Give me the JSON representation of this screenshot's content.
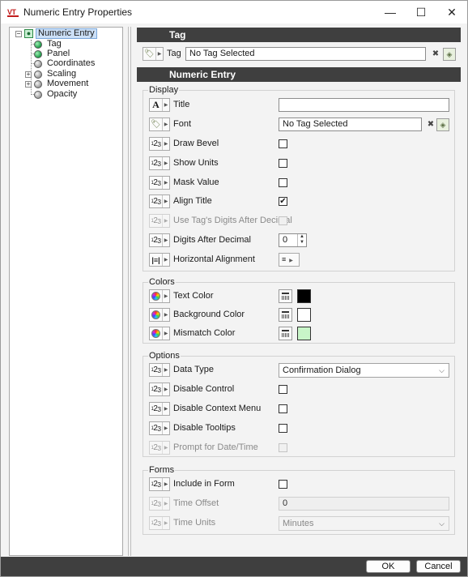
{
  "window": {
    "title": "Numeric Entry Properties",
    "logo": "VT",
    "controls": {
      "minimize": "—",
      "maximize": "☐",
      "close": "✕"
    }
  },
  "tree": {
    "root": {
      "label": "Numeric Entry",
      "expander": "−"
    },
    "items": [
      {
        "label": "Tag",
        "icon": "green",
        "expander": ""
      },
      {
        "label": "Panel",
        "icon": "green",
        "expander": ""
      },
      {
        "label": "Coordinates",
        "icon": "gray",
        "expander": ""
      },
      {
        "label": "Scaling",
        "icon": "gray",
        "expander": "+"
      },
      {
        "label": "Movement",
        "icon": "gray",
        "expander": "+"
      },
      {
        "label": "Opacity",
        "icon": "gray",
        "expander": ""
      }
    ]
  },
  "tag_section": {
    "header": "Tag",
    "label": "Tag",
    "value": "No Tag Selected"
  },
  "numeric_section": {
    "header": "Numeric Entry",
    "display": {
      "title": "Display",
      "title_prop": {
        "label": "Title",
        "value": ""
      },
      "font": {
        "label": "Font",
        "value": "No Tag Selected"
      },
      "draw_bevel": {
        "label": "Draw Bevel",
        "checked": false
      },
      "show_units": {
        "label": "Show Units",
        "checked": false
      },
      "mask_value": {
        "label": "Mask Value",
        "checked": false
      },
      "align_title": {
        "label": "Align Title",
        "checked": true,
        "mark": "✔"
      },
      "use_tag_digits": {
        "label": "Use Tag's Digits After Decimal",
        "checked": false,
        "disabled": true
      },
      "digits_after_decimal": {
        "label": "Digits After Decimal",
        "value": "0"
      },
      "horizontal_alignment": {
        "label": "Horizontal Alignment"
      }
    },
    "colors": {
      "title": "Colors",
      "text_color": {
        "label": "Text Color",
        "color": "#000000"
      },
      "background_color": {
        "label": "Background Color",
        "color": "#ffffff"
      },
      "mismatch_color": {
        "label": "Mismatch Color",
        "color": "#c8f5c8"
      }
    },
    "options": {
      "title": "Options",
      "data_type": {
        "label": "Data Type",
        "value": "Confirmation Dialog"
      },
      "disable_control": {
        "label": "Disable Control",
        "checked": false
      },
      "disable_context_menu": {
        "label": "Disable Context Menu",
        "checked": false
      },
      "disable_tooltips": {
        "label": "Disable Tooltips",
        "checked": false
      },
      "prompt_date_time": {
        "label": "Prompt for Date/Time",
        "checked": false,
        "disabled": true
      }
    },
    "forms": {
      "title": "Forms",
      "include_in_form": {
        "label": "Include in Form",
        "checked": false
      },
      "time_offset": {
        "label": "Time Offset",
        "value": "0"
      },
      "time_units": {
        "label": "Time Units",
        "value": "Minutes"
      }
    }
  },
  "footer": {
    "ok_label": "OK",
    "cancel_label": "Cancel"
  },
  "icons": {
    "numeric": "123",
    "title_glyph": "A",
    "clear": "✖",
    "tag_browse": "🏷",
    "align_glyph": "|≡|",
    "align_value_glyph": "≡"
  }
}
